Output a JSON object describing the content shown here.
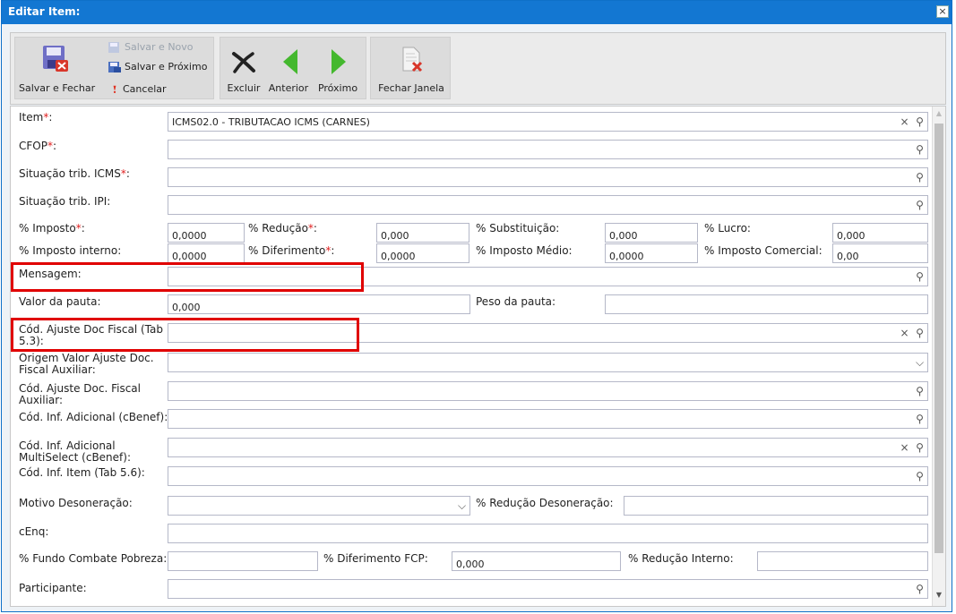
{
  "window": {
    "title": "Editar Item:",
    "close": "×"
  },
  "toolbar": {
    "save_close": "Salvar e Fechar",
    "save_new": "Salvar e Novo",
    "save_next": "Salvar e Próximo",
    "cancel": "Cancelar",
    "delete": "Excluir",
    "previous": "Anterior",
    "next": "Próximo",
    "close_window": "Fechar Janela"
  },
  "icons": {
    "clear": "×",
    "search": "⚲",
    "dropdown": "⌵",
    "scroll_up": "▲",
    "scroll_down": "▼"
  },
  "form": {
    "item": {
      "label": "Item",
      "req": "*",
      "colon": ":",
      "value": "ICMS02.0 - TRIBUTACAO ICMS (CARNES)"
    },
    "cfop": {
      "label": "CFOP",
      "req": "*",
      "colon": ":",
      "value": ""
    },
    "sit_icms": {
      "label": "Situação trib. ICMS",
      "req": "*",
      "colon": ":",
      "value": ""
    },
    "sit_ipi": {
      "label": "Situação trib. IPI:",
      "value": ""
    },
    "imposto": {
      "label": "% Imposto",
      "req": "*",
      "colon": ":",
      "value": "0,0000"
    },
    "reducao": {
      "label": "% Redução",
      "req": "*",
      "colon": ":",
      "value": "0,000"
    },
    "substituicao": {
      "label": "% Substituição:",
      "value": "0,000"
    },
    "lucro": {
      "label": "% Lucro:",
      "value": "0,000"
    },
    "imposto_interno": {
      "label": "% Imposto interno:",
      "value": "0,0000"
    },
    "diferimento": {
      "label": "% Diferimento",
      "req": "*",
      "colon": ":",
      "value": "0,0000"
    },
    "imposto_medio": {
      "label": "% Imposto Médio:",
      "value": "0,0000"
    },
    "imposto_comercial": {
      "label": "% Imposto Comercial:",
      "value": "0,00"
    },
    "mensagem": {
      "label": "Mensagem:",
      "value": ""
    },
    "valor_pauta": {
      "label": "Valor da pauta:",
      "value": "0,000"
    },
    "peso_pauta": {
      "label": "Peso da pauta:",
      "value": ""
    },
    "cod_ajuste": {
      "label1": "Cód. Ajuste Doc Fiscal (Tab",
      "label2": "5.3):",
      "value": ""
    },
    "origem_valor": {
      "label1": "Origem Valor Ajuste Doc.",
      "label2": "Fiscal Auxiliar:",
      "value": ""
    },
    "cod_ajuste_aux": {
      "label1": "Cód. Ajuste Doc. Fiscal",
      "label2": "Auxiliar:",
      "value": ""
    },
    "cod_inf_adicional": {
      "label": "Cód. Inf. Adicional (cBenef):",
      "value": ""
    },
    "cod_inf_multi": {
      "label1": "Cód. Inf. Adicional",
      "label2": "MultiSelect (cBenef):",
      "value": ""
    },
    "cod_inf_item": {
      "label": "Cód. Inf. Item (Tab 5.6):",
      "value": ""
    },
    "motivo_desoneracao": {
      "label": "Motivo Desoneração:",
      "value": ""
    },
    "reducao_desoneracao": {
      "label": "% Redução Desoneração:",
      "value": ""
    },
    "cenq": {
      "label": "cEnq:",
      "value": ""
    },
    "fundo_pobreza": {
      "label": "% Fundo Combate Pobreza:",
      "value": ""
    },
    "diferimento_fcp": {
      "label": "% Diferimento FCP:",
      "value": "0,000"
    },
    "reducao_interno": {
      "label": "% Redução Interno:",
      "value": ""
    },
    "participante": {
      "label": "Participante:",
      "value": ""
    }
  },
  "colors": {
    "title_bar": "#1377d2",
    "required": "#e02020",
    "highlight": "#e00000"
  }
}
